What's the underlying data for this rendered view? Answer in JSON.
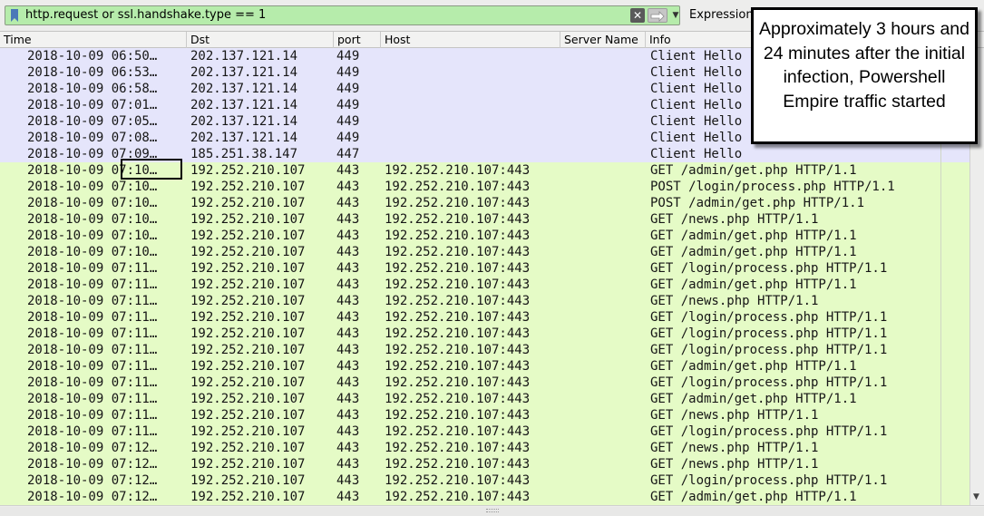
{
  "filter": {
    "expression": "http.request or ssl.handshake.type == 1",
    "expression_button_label": "Expression…"
  },
  "columns": [
    {
      "label": "Time"
    },
    {
      "label": "Dst"
    },
    {
      "label": "port"
    },
    {
      "label": "Host"
    },
    {
      "label": "Server Name"
    },
    {
      "label": "Info"
    }
  ],
  "rows": [
    {
      "type": "tls",
      "time": "2018-10-09 06:50…",
      "dst": "202.137.121.14",
      "port": "449",
      "host": "",
      "server_name": "",
      "info": "Client Hello"
    },
    {
      "type": "tls",
      "time": "2018-10-09 06:53…",
      "dst": "202.137.121.14",
      "port": "449",
      "host": "",
      "server_name": "",
      "info": "Client Hello"
    },
    {
      "type": "tls",
      "time": "2018-10-09 06:58…",
      "dst": "202.137.121.14",
      "port": "449",
      "host": "",
      "server_name": "",
      "info": "Client Hello"
    },
    {
      "type": "tls",
      "time": "2018-10-09 07:01…",
      "dst": "202.137.121.14",
      "port": "449",
      "host": "",
      "server_name": "",
      "info": "Client Hello"
    },
    {
      "type": "tls",
      "time": "2018-10-09 07:05…",
      "dst": "202.137.121.14",
      "port": "449",
      "host": "",
      "server_name": "",
      "info": "Client Hello"
    },
    {
      "type": "tls",
      "time": "2018-10-09 07:08…",
      "dst": "202.137.121.14",
      "port": "449",
      "host": "",
      "server_name": "",
      "info": "Client Hello"
    },
    {
      "type": "tls",
      "time": "2018-10-09 07:09…",
      "dst": "185.251.38.147",
      "port": "447",
      "host": "",
      "server_name": "",
      "info": "Client Hello"
    },
    {
      "type": "http",
      "time": "2018-10-09 07:10…",
      "dst": "192.252.210.107",
      "port": "443",
      "host": "192.252.210.107:443",
      "server_name": "",
      "info": "GET /admin/get.php HTTP/1.1"
    },
    {
      "type": "http",
      "time": "2018-10-09 07:10…",
      "dst": "192.252.210.107",
      "port": "443",
      "host": "192.252.210.107:443",
      "server_name": "",
      "info": "POST /login/process.php HTTP/1.1"
    },
    {
      "type": "http",
      "time": "2018-10-09 07:10…",
      "dst": "192.252.210.107",
      "port": "443",
      "host": "192.252.210.107:443",
      "server_name": "",
      "info": "POST /admin/get.php HTTP/1.1"
    },
    {
      "type": "http",
      "time": "2018-10-09 07:10…",
      "dst": "192.252.210.107",
      "port": "443",
      "host": "192.252.210.107:443",
      "server_name": "",
      "info": "GET /news.php HTTP/1.1"
    },
    {
      "type": "http",
      "time": "2018-10-09 07:10…",
      "dst": "192.252.210.107",
      "port": "443",
      "host": "192.252.210.107:443",
      "server_name": "",
      "info": "GET /admin/get.php HTTP/1.1"
    },
    {
      "type": "http",
      "time": "2018-10-09 07:10…",
      "dst": "192.252.210.107",
      "port": "443",
      "host": "192.252.210.107:443",
      "server_name": "",
      "info": "GET /admin/get.php HTTP/1.1"
    },
    {
      "type": "http",
      "time": "2018-10-09 07:11…",
      "dst": "192.252.210.107",
      "port": "443",
      "host": "192.252.210.107:443",
      "server_name": "",
      "info": "GET /login/process.php HTTP/1.1"
    },
    {
      "type": "http",
      "time": "2018-10-09 07:11…",
      "dst": "192.252.210.107",
      "port": "443",
      "host": "192.252.210.107:443",
      "server_name": "",
      "info": "GET /admin/get.php HTTP/1.1"
    },
    {
      "type": "http",
      "time": "2018-10-09 07:11…",
      "dst": "192.252.210.107",
      "port": "443",
      "host": "192.252.210.107:443",
      "server_name": "",
      "info": "GET /news.php HTTP/1.1"
    },
    {
      "type": "http",
      "time": "2018-10-09 07:11…",
      "dst": "192.252.210.107",
      "port": "443",
      "host": "192.252.210.107:443",
      "server_name": "",
      "info": "GET /login/process.php HTTP/1.1"
    },
    {
      "type": "http",
      "time": "2018-10-09 07:11…",
      "dst": "192.252.210.107",
      "port": "443",
      "host": "192.252.210.107:443",
      "server_name": "",
      "info": "GET /login/process.php HTTP/1.1"
    },
    {
      "type": "http",
      "time": "2018-10-09 07:11…",
      "dst": "192.252.210.107",
      "port": "443",
      "host": "192.252.210.107:443",
      "server_name": "",
      "info": "GET /login/process.php HTTP/1.1"
    },
    {
      "type": "http",
      "time": "2018-10-09 07:11…",
      "dst": "192.252.210.107",
      "port": "443",
      "host": "192.252.210.107:443",
      "server_name": "",
      "info": "GET /admin/get.php HTTP/1.1"
    },
    {
      "type": "http",
      "time": "2018-10-09 07:11…",
      "dst": "192.252.210.107",
      "port": "443",
      "host": "192.252.210.107:443",
      "server_name": "",
      "info": "GET /login/process.php HTTP/1.1"
    },
    {
      "type": "http",
      "time": "2018-10-09 07:11…",
      "dst": "192.252.210.107",
      "port": "443",
      "host": "192.252.210.107:443",
      "server_name": "",
      "info": "GET /admin/get.php HTTP/1.1"
    },
    {
      "type": "http",
      "time": "2018-10-09 07:11…",
      "dst": "192.252.210.107",
      "port": "443",
      "host": "192.252.210.107:443",
      "server_name": "",
      "info": "GET /news.php HTTP/1.1"
    },
    {
      "type": "http",
      "time": "2018-10-09 07:11…",
      "dst": "192.252.210.107",
      "port": "443",
      "host": "192.252.210.107:443",
      "server_name": "",
      "info": "GET /login/process.php HTTP/1.1"
    },
    {
      "type": "http",
      "time": "2018-10-09 07:12…",
      "dst": "192.252.210.107",
      "port": "443",
      "host": "192.252.210.107:443",
      "server_name": "",
      "info": "GET /news.php HTTP/1.1"
    },
    {
      "type": "http",
      "time": "2018-10-09 07:12…",
      "dst": "192.252.210.107",
      "port": "443",
      "host": "192.252.210.107:443",
      "server_name": "",
      "info": "GET /news.php HTTP/1.1"
    },
    {
      "type": "http",
      "time": "2018-10-09 07:12…",
      "dst": "192.252.210.107",
      "port": "443",
      "host": "192.252.210.107:443",
      "server_name": "",
      "info": "GET /login/process.php HTTP/1.1"
    },
    {
      "type": "http",
      "time": "2018-10-09 07:12…",
      "dst": "192.252.210.107",
      "port": "443",
      "host": "192.252.210.107:443",
      "server_name": "",
      "info": "GET /admin/get.php HTTP/1.1"
    }
  ],
  "annotation": {
    "text": "Approximately 3 hours and 24 minutes after the initial infection, Powershell Empire traffic started"
  },
  "colors": {
    "filter_valid": "#b6ecab",
    "tls_row": "#e5e5fb",
    "http_row": "#e5fbc6"
  }
}
